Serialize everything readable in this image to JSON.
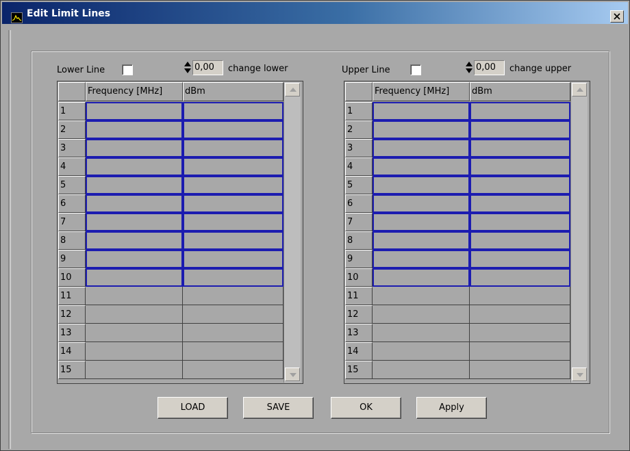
{
  "window": {
    "title": "Edit Limit Lines"
  },
  "lower": {
    "label": "Lower Line",
    "checked": false,
    "value": "0,00",
    "change_label": "change lower",
    "columns": [
      "Frequency [MHz]",
      "dBm"
    ],
    "rows": [
      "1",
      "2",
      "3",
      "4",
      "5",
      "6",
      "7",
      "8",
      "9",
      "10",
      "11",
      "12",
      "13",
      "14",
      "15"
    ]
  },
  "upper": {
    "label": "Upper Line",
    "checked": false,
    "value": "0,00",
    "change_label": "change upper",
    "columns": [
      "Frequency [MHz]",
      "dBm"
    ],
    "rows": [
      "1",
      "2",
      "3",
      "4",
      "5",
      "6",
      "7",
      "8",
      "9",
      "10",
      "11",
      "12",
      "13",
      "14",
      "15"
    ]
  },
  "buttons": {
    "load": "LOAD",
    "save": "SAVE",
    "ok": "OK",
    "apply": "Apply"
  },
  "colors": {
    "active_cell_border": "#1c1cb0",
    "title_gradient_start": "#0a246a"
  }
}
